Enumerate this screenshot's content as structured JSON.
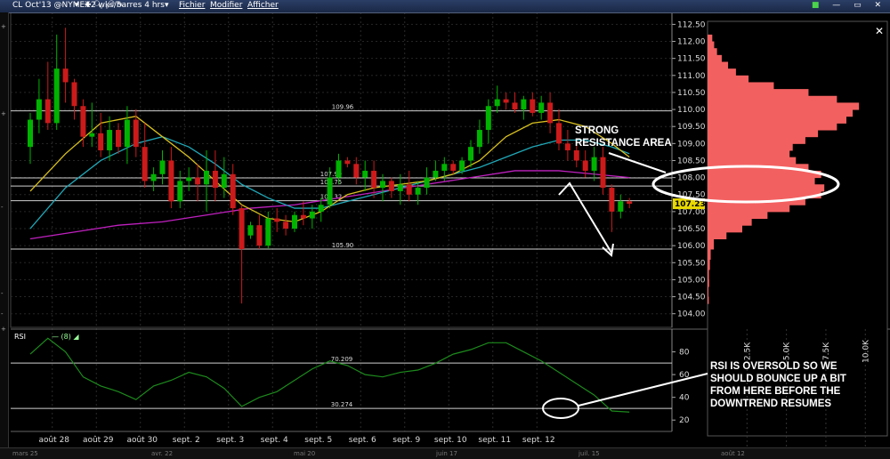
{
  "toolbar": {
    "symbol": "CL Oct'13 @NYMEX",
    "timeframe": "2 wks/barres 4 hrs",
    "menu": [
      "Fichier",
      "Modifier",
      "Afficher"
    ]
  },
  "rsi_panel": {
    "label": "RSI",
    "param": "(8)"
  },
  "annotations": {
    "resistance": [
      "STRONG",
      "RESISTANCE AREA"
    ],
    "rsi_note": [
      "RSI IS OVERSOLD SO WE",
      "SHOULD BOUNCE UP A BIT",
      "FROM HERE BEFORE THE",
      "DOWNTREND RESUMES"
    ]
  },
  "left_strip": [
    "+",
    "+",
    "-",
    "-",
    "-",
    "+"
  ],
  "bottom_nav": [
    "mars 25",
    "avr. 22",
    "mai 20",
    "juin 17",
    "juil. 15",
    "août 12"
  ],
  "colors": {
    "up": "#00b300",
    "down": "#cc1a1a",
    "ma_fast": "#d8c020",
    "ma_mid": "#20a8b8",
    "ma_slow": "#c020c0",
    "rsi": "#1d8a1d",
    "profile": "#f36060",
    "annotation": "#ffffff",
    "last_price_bg": "#e8d800"
  },
  "chart_data": [
    {
      "type": "candlestick",
      "x_labels": [
        "août 28",
        "août 29",
        "août 30",
        "sept. 2",
        "sept. 3",
        "sept. 4",
        "sept. 5",
        "sept. 6",
        "sept. 9",
        "sept. 10",
        "sept. 11",
        "sept. 12"
      ],
      "y_ticks": [
        104.0,
        104.5,
        105.0,
        105.5,
        106.0,
        106.5,
        107.0,
        107.5,
        108.0,
        108.5,
        109.0,
        109.5,
        110.0,
        110.5,
        111.0,
        111.5,
        112.0,
        112.5
      ],
      "y_tick_labels": [
        "104.00",
        "104.50",
        "105.00",
        "105.50",
        "106.00",
        "106.50",
        "107.00",
        "107.50",
        "108.00",
        "108.50",
        "109.00",
        "109.50",
        "110.00",
        "110.50",
        "111.00",
        "111.50",
        "112.00",
        "112.50"
      ],
      "ylim": [
        103.6,
        112.85
      ],
      "hlines": [
        {
          "value": 109.96,
          "label": "109.96"
        },
        {
          "value": 107.99,
          "label": "107.99"
        },
        {
          "value": 107.75,
          "label": "107.75"
        },
        {
          "value": 107.32,
          "label": "107.32"
        },
        {
          "value": 105.9,
          "label": "105.90"
        }
      ],
      "last_price": "107.23",
      "ohlc": [
        {
          "x": 0.0,
          "o": 108.9,
          "h": 109.9,
          "l": 108.4,
          "c": 109.7
        },
        {
          "x": 0.2,
          "o": 109.7,
          "h": 110.9,
          "l": 109.3,
          "c": 110.3
        },
        {
          "x": 0.4,
          "o": 110.3,
          "h": 111.4,
          "l": 109.4,
          "c": 109.6
        },
        {
          "x": 0.6,
          "o": 109.6,
          "h": 112.2,
          "l": 109.4,
          "c": 111.2
        },
        {
          "x": 0.8,
          "o": 111.2,
          "h": 112.4,
          "l": 110.2,
          "c": 110.8
        },
        {
          "x": 1.0,
          "o": 110.8,
          "h": 110.9,
          "l": 109.7,
          "c": 110.1
        },
        {
          "x": 1.2,
          "o": 110.1,
          "h": 110.3,
          "l": 108.9,
          "c": 109.2
        },
        {
          "x": 1.4,
          "o": 109.2,
          "h": 110.2,
          "l": 108.9,
          "c": 109.3
        },
        {
          "x": 1.6,
          "o": 109.3,
          "h": 109.9,
          "l": 108.6,
          "c": 108.8
        },
        {
          "x": 1.8,
          "o": 108.8,
          "h": 109.8,
          "l": 108.5,
          "c": 109.4
        },
        {
          "x": 2.0,
          "o": 109.4,
          "h": 109.6,
          "l": 108.7,
          "c": 108.9
        },
        {
          "x": 2.2,
          "o": 108.9,
          "h": 110.1,
          "l": 108.4,
          "c": 109.7
        },
        {
          "x": 2.4,
          "o": 109.7,
          "h": 110.0,
          "l": 108.6,
          "c": 108.9
        },
        {
          "x": 2.6,
          "o": 108.9,
          "h": 109.6,
          "l": 107.7,
          "c": 107.9
        },
        {
          "x": 2.8,
          "o": 107.9,
          "h": 108.3,
          "l": 107.6,
          "c": 108.1
        },
        {
          "x": 3.0,
          "o": 108.1,
          "h": 108.8,
          "l": 107.8,
          "c": 108.5
        },
        {
          "x": 3.2,
          "o": 108.5,
          "h": 108.9,
          "l": 107.1,
          "c": 107.3
        },
        {
          "x": 3.4,
          "o": 107.3,
          "h": 108.2,
          "l": 107.1,
          "c": 107.9
        },
        {
          "x": 3.6,
          "o": 107.9,
          "h": 108.3,
          "l": 107.6,
          "c": 108.0
        },
        {
          "x": 3.8,
          "o": 108.0,
          "h": 108.4,
          "l": 107.3,
          "c": 107.8
        },
        {
          "x": 4.0,
          "o": 107.8,
          "h": 108.8,
          "l": 107.0,
          "c": 108.2
        },
        {
          "x": 4.2,
          "o": 108.2,
          "h": 108.8,
          "l": 107.3,
          "c": 107.7
        },
        {
          "x": 4.4,
          "o": 107.7,
          "h": 108.6,
          "l": 107.4,
          "c": 108.1
        },
        {
          "x": 4.6,
          "o": 108.1,
          "h": 108.4,
          "l": 106.9,
          "c": 107.1
        },
        {
          "x": 4.8,
          "o": 107.1,
          "h": 107.2,
          "l": 104.3,
          "c": 105.9
        },
        {
          "x": 5.0,
          "o": 106.3,
          "h": 106.7,
          "l": 106.2,
          "c": 106.6
        },
        {
          "x": 5.2,
          "o": 106.6,
          "h": 106.9,
          "l": 105.9,
          "c": 106.0
        },
        {
          "x": 5.4,
          "o": 106.0,
          "h": 107.0,
          "l": 105.9,
          "c": 106.8
        },
        {
          "x": 5.6,
          "o": 106.8,
          "h": 107.1,
          "l": 106.4,
          "c": 106.7
        },
        {
          "x": 5.8,
          "o": 106.7,
          "h": 106.9,
          "l": 106.3,
          "c": 106.5
        },
        {
          "x": 6.0,
          "o": 106.5,
          "h": 107.0,
          "l": 106.4,
          "c": 106.9
        },
        {
          "x": 6.2,
          "o": 106.9,
          "h": 107.3,
          "l": 106.6,
          "c": 106.8
        },
        {
          "x": 6.4,
          "o": 106.8,
          "h": 107.2,
          "l": 106.5,
          "c": 107.0
        },
        {
          "x": 6.6,
          "o": 107.0,
          "h": 107.4,
          "l": 106.7,
          "c": 107.2
        },
        {
          "x": 6.8,
          "o": 107.2,
          "h": 108.3,
          "l": 107.1,
          "c": 108.0
        },
        {
          "x": 7.0,
          "o": 108.0,
          "h": 108.7,
          "l": 107.8,
          "c": 108.5
        },
        {
          "x": 7.2,
          "o": 108.5,
          "h": 108.6,
          "l": 108.3,
          "c": 108.4
        },
        {
          "x": 7.4,
          "o": 108.4,
          "h": 108.6,
          "l": 107.8,
          "c": 108.0
        },
        {
          "x": 7.6,
          "o": 108.0,
          "h": 108.5,
          "l": 107.6,
          "c": 108.2
        },
        {
          "x": 7.8,
          "o": 108.2,
          "h": 108.5,
          "l": 107.4,
          "c": 107.7
        },
        {
          "x": 8.0,
          "o": 107.7,
          "h": 108.1,
          "l": 107.3,
          "c": 107.9
        },
        {
          "x": 8.2,
          "o": 107.9,
          "h": 108.0,
          "l": 107.4,
          "c": 107.6
        },
        {
          "x": 8.4,
          "o": 107.6,
          "h": 108.1,
          "l": 107.2,
          "c": 107.8
        },
        {
          "x": 8.6,
          "o": 107.8,
          "h": 108.2,
          "l": 107.3,
          "c": 107.5
        },
        {
          "x": 8.8,
          "o": 107.5,
          "h": 107.9,
          "l": 107.2,
          "c": 107.7
        },
        {
          "x": 9.0,
          "o": 107.7,
          "h": 108.3,
          "l": 107.5,
          "c": 108.0
        },
        {
          "x": 9.2,
          "o": 108.0,
          "h": 108.5,
          "l": 107.9,
          "c": 108.2
        },
        {
          "x": 9.4,
          "o": 108.2,
          "h": 108.6,
          "l": 107.9,
          "c": 108.4
        },
        {
          "x": 9.6,
          "o": 108.4,
          "h": 108.5,
          "l": 108.1,
          "c": 108.2
        },
        {
          "x": 9.8,
          "o": 108.2,
          "h": 108.6,
          "l": 108.1,
          "c": 108.5
        },
        {
          "x": 10.0,
          "o": 108.5,
          "h": 109.1,
          "l": 108.3,
          "c": 108.9
        },
        {
          "x": 10.2,
          "o": 108.9,
          "h": 109.7,
          "l": 108.7,
          "c": 109.4
        },
        {
          "x": 10.4,
          "o": 109.4,
          "h": 110.3,
          "l": 109.0,
          "c": 110.1
        },
        {
          "x": 10.6,
          "o": 110.1,
          "h": 110.7,
          "l": 109.9,
          "c": 110.3
        },
        {
          "x": 10.8,
          "o": 110.3,
          "h": 110.5,
          "l": 110.0,
          "c": 110.2
        },
        {
          "x": 11.0,
          "o": 110.2,
          "h": 110.5,
          "l": 109.9,
          "c": 110.0
        },
        {
          "x": 11.2,
          "o": 110.0,
          "h": 110.4,
          "l": 109.7,
          "c": 110.3
        },
        {
          "x": 11.4,
          "o": 110.3,
          "h": 110.5,
          "l": 109.8,
          "c": 109.9
        },
        {
          "x": 11.6,
          "o": 109.9,
          "h": 110.4,
          "l": 109.7,
          "c": 110.2
        },
        {
          "x": 11.8,
          "o": 110.2,
          "h": 110.5,
          "l": 109.3,
          "c": 109.6
        },
        {
          "x": 12.0,
          "o": 109.6,
          "h": 110.0,
          "l": 108.8,
          "c": 109.0
        },
        {
          "x": 12.2,
          "o": 109.0,
          "h": 109.4,
          "l": 108.5,
          "c": 108.8
        },
        {
          "x": 12.4,
          "o": 108.8,
          "h": 109.0,
          "l": 108.3,
          "c": 108.5
        },
        {
          "x": 12.6,
          "o": 108.5,
          "h": 108.8,
          "l": 108.0,
          "c": 108.2
        },
        {
          "x": 12.8,
          "o": 108.2,
          "h": 108.9,
          "l": 107.9,
          "c": 108.6
        },
        {
          "x": 13.0,
          "o": 108.6,
          "h": 108.9,
          "l": 107.5,
          "c": 107.7
        },
        {
          "x": 13.2,
          "o": 107.7,
          "h": 107.8,
          "l": 106.4,
          "c": 107.0
        },
        {
          "x": 13.4,
          "o": 107.0,
          "h": 107.5,
          "l": 106.8,
          "c": 107.3
        },
        {
          "x": 13.6,
          "o": 107.3,
          "h": 107.4,
          "l": 107.1,
          "c": 107.23
        }
      ],
      "ma_fast": [
        [
          0.0,
          107.6
        ],
        [
          0.8,
          108.7
        ],
        [
          1.6,
          109.6
        ],
        [
          2.4,
          109.8
        ],
        [
          3.0,
          109.2
        ],
        [
          3.6,
          108.6
        ],
        [
          4.2,
          107.9
        ],
        [
          4.8,
          107.2
        ],
        [
          5.4,
          106.8
        ],
        [
          6.0,
          106.7
        ],
        [
          6.6,
          107.0
        ],
        [
          7.2,
          107.5
        ],
        [
          7.8,
          107.7
        ],
        [
          8.4,
          107.8
        ],
        [
          9.0,
          107.9
        ],
        [
          9.6,
          108.1
        ],
        [
          10.2,
          108.5
        ],
        [
          10.8,
          109.2
        ],
        [
          11.4,
          109.6
        ],
        [
          12.0,
          109.7
        ],
        [
          12.6,
          109.5
        ],
        [
          13.2,
          109.0
        ],
        [
          13.6,
          108.6
        ]
      ],
      "ma_mid": [
        [
          0.0,
          106.5
        ],
        [
          0.8,
          107.7
        ],
        [
          1.6,
          108.5
        ],
        [
          2.4,
          109.0
        ],
        [
          3.0,
          109.2
        ],
        [
          3.6,
          108.9
        ],
        [
          4.2,
          108.4
        ],
        [
          4.8,
          107.8
        ],
        [
          5.4,
          107.4
        ],
        [
          6.0,
          107.1
        ],
        [
          6.6,
          107.1
        ],
        [
          7.2,
          107.3
        ],
        [
          7.8,
          107.5
        ],
        [
          8.4,
          107.7
        ],
        [
          9.0,
          107.9
        ],
        [
          9.6,
          108.1
        ],
        [
          10.2,
          108.3
        ],
        [
          10.8,
          108.6
        ],
        [
          11.4,
          108.9
        ],
        [
          12.0,
          109.1
        ],
        [
          12.6,
          109.1
        ],
        [
          13.2,
          108.9
        ],
        [
          13.6,
          108.7
        ]
      ],
      "ma_slow": [
        [
          0.0,
          106.2
        ],
        [
          1.0,
          106.4
        ],
        [
          2.0,
          106.6
        ],
        [
          3.0,
          106.7
        ],
        [
          4.0,
          106.9
        ],
        [
          5.0,
          107.1
        ],
        [
          6.0,
          107.2
        ],
        [
          7.0,
          107.4
        ],
        [
          8.0,
          107.6
        ],
        [
          9.0,
          107.8
        ],
        [
          10.0,
          108.0
        ],
        [
          11.0,
          108.2
        ],
        [
          12.0,
          108.2
        ],
        [
          12.8,
          108.1
        ],
        [
          13.6,
          108.0
        ]
      ]
    },
    {
      "type": "line",
      "series": [
        {
          "name": "RSI",
          "values": [
            [
              0.0,
              78
            ],
            [
              0.4,
              92
            ],
            [
              0.8,
              80
            ],
            [
              1.2,
              58
            ],
            [
              1.6,
              50
            ],
            [
              2.0,
              45
            ],
            [
              2.4,
              38
            ],
            [
              2.8,
              50
            ],
            [
              3.2,
              55
            ],
            [
              3.6,
              62
            ],
            [
              4.0,
              58
            ],
            [
              4.4,
              48
            ],
            [
              4.8,
              32
            ],
            [
              5.2,
              40
            ],
            [
              5.6,
              45
            ],
            [
              6.0,
              55
            ],
            [
              6.4,
              65
            ],
            [
              6.8,
              72
            ],
            [
              7.2,
              68
            ],
            [
              7.6,
              60
            ],
            [
              8.0,
              58
            ],
            [
              8.4,
              62
            ],
            [
              8.8,
              64
            ],
            [
              9.2,
              70
            ],
            [
              9.6,
              78
            ],
            [
              10.0,
              82
            ],
            [
              10.4,
              88
            ],
            [
              10.8,
              88
            ],
            [
              11.2,
              80
            ],
            [
              11.6,
              72
            ],
            [
              12.0,
              62
            ],
            [
              12.4,
              52
            ],
            [
              12.8,
              42
            ],
            [
              13.2,
              28
            ],
            [
              13.6,
              27
            ]
          ]
        }
      ],
      "y_ticks": [
        20,
        40,
        60,
        80
      ],
      "hlines": [
        {
          "value": 70.209,
          "label": "70.209"
        },
        {
          "value": 30.274,
          "label": "30.274"
        }
      ],
      "ylim": [
        10,
        100
      ]
    },
    {
      "type": "bar",
      "orientation": "horizontal",
      "x_ticks": [
        "2.5K",
        "5.0K",
        "7.5K",
        "10.0K"
      ],
      "xlim": [
        0,
        11000
      ],
      "profile": [
        [
          104.3,
          80
        ],
        [
          104.5,
          60
        ],
        [
          104.8,
          100
        ],
        [
          105.0,
          90
        ],
        [
          105.3,
          150
        ],
        [
          105.6,
          200
        ],
        [
          105.9,
          400
        ],
        [
          106.2,
          1200
        ],
        [
          106.4,
          2200
        ],
        [
          106.6,
          2800
        ],
        [
          106.8,
          3800
        ],
        [
          107.0,
          5200
        ],
        [
          107.2,
          6200
        ],
        [
          107.4,
          7200
        ],
        [
          107.6,
          7400
        ],
        [
          107.8,
          6800
        ],
        [
          108.0,
          7200
        ],
        [
          108.2,
          6400
        ],
        [
          108.4,
          5600
        ],
        [
          108.6,
          5200
        ],
        [
          108.8,
          5400
        ],
        [
          109.0,
          6200
        ],
        [
          109.2,
          7000
        ],
        [
          109.4,
          8200
        ],
        [
          109.6,
          8800
        ],
        [
          109.8,
          9200
        ],
        [
          110.0,
          9600
        ],
        [
          110.2,
          8200
        ],
        [
          110.4,
          6400
        ],
        [
          110.6,
          4200
        ],
        [
          110.8,
          2600
        ],
        [
          111.0,
          1800
        ],
        [
          111.2,
          1300
        ],
        [
          111.4,
          900
        ],
        [
          111.6,
          600
        ],
        [
          111.8,
          420
        ],
        [
          112.0,
          300
        ],
        [
          112.2,
          180
        ]
      ]
    }
  ]
}
